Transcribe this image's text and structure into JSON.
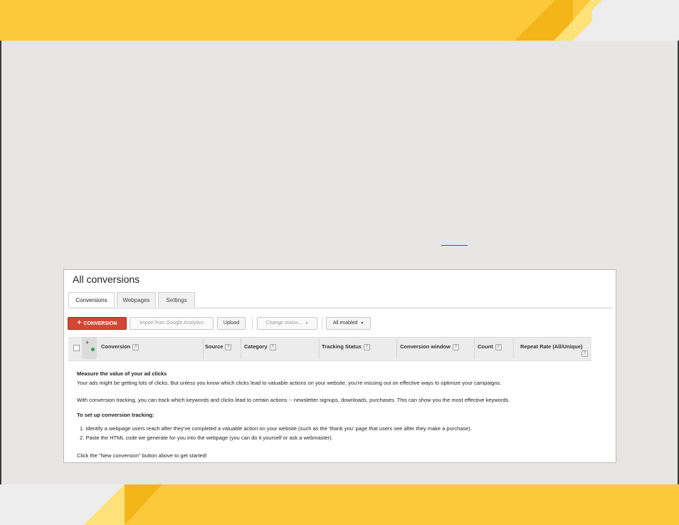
{
  "colors": {
    "banner_main": "#fbc93b",
    "banner_dark": "#f3b518",
    "banner_light": "#fde179",
    "banner_corner": "#ededed",
    "primary_red": "#d14836"
  },
  "panel": {
    "title": "All conversions",
    "tabs": [
      {
        "label": "Conversions"
      },
      {
        "label": "Webpages"
      },
      {
        "label": "Settings"
      }
    ],
    "toolbar": {
      "new_conversion": "CONVERSION",
      "import_ga": "Import from Google Analytics",
      "upload": "Upload",
      "change_status": "Change status...",
      "all_enabled": "All enabled"
    },
    "columns": {
      "conversion": "Conversion",
      "source": "Source",
      "category": "Category",
      "tracking_status": "Tracking Status",
      "conversion_window": "Conversion window",
      "count": "Count",
      "repeat_rate": "Repeat Rate (All/Unique)"
    },
    "help_glyph": "?",
    "empty_state": {
      "heading": "Measure the value of your ad clicks",
      "para1": "Your ads might be getting lots of clicks. But unless you know which clicks lead to valuable actions on your website, you're missing out on effective ways to optimize your campaigns.",
      "para2": "With conversion tracking, you can track which keywords and clicks lead to certain actions -- newsletter signups, downloads, purchases. This can show you the most effective keywords.",
      "setup_heading": "To set up conversion tracking:",
      "step1": "1.  Identify a webpage users reach after they've completed a valuable action on your website (such as the 'thank you' page that users see after they make a purchase).",
      "step2": "2.  Paste the HTML code we generate for you into the webpage (you can do it yourself or ask a webmaster).",
      "cta": "Click the \"New conversion\" button above to get started!"
    }
  }
}
